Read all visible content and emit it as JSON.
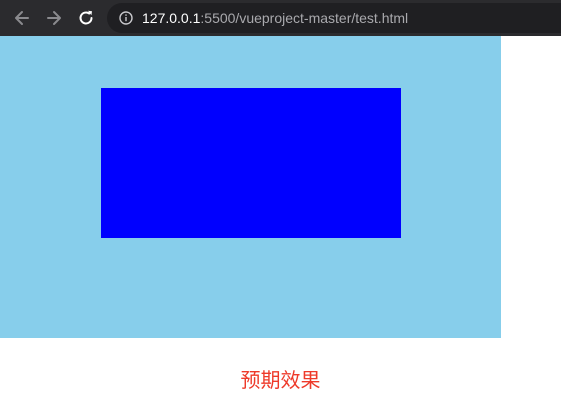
{
  "browser": {
    "url_host": "127.0.0.1",
    "url_path": ":5500/vueproject-master/test.html",
    "toolbar_color": "#2b2b2e",
    "icons": [
      "back-arrow-icon",
      "forward-arrow-icon",
      "reload-icon",
      "info-icon"
    ]
  },
  "page": {
    "outer_box_color": "#87ceeb",
    "inner_box_color": "#0000ff",
    "caption": "预期效果",
    "caption_color": "#ee3a2a"
  }
}
